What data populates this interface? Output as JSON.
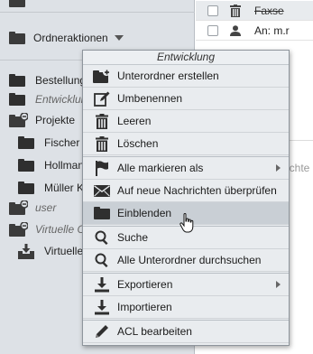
{
  "sidebar": {
    "folder_actions_label": "Ordneraktionen",
    "items": [
      {
        "label": "Bestellung",
        "indent": 0,
        "style": "normal",
        "icon": "folder-icon"
      },
      {
        "label": "Entwicklun",
        "indent": 0,
        "style": "italic",
        "icon": "folder-icon"
      },
      {
        "label": "Projekte",
        "indent": 0,
        "style": "normal",
        "icon": "folder-collapse-icon"
      },
      {
        "label": "Fischer",
        "indent": 1,
        "style": "normal",
        "icon": "folder-icon"
      },
      {
        "label": "Hollman",
        "indent": 1,
        "style": "normal",
        "icon": "folder-icon"
      },
      {
        "label": "Müller K",
        "indent": 1,
        "style": "normal",
        "icon": "folder-icon"
      },
      {
        "label": "user",
        "indent": 0,
        "style": "italic",
        "icon": "folder-collapse-icon"
      },
      {
        "label": "Virtuelle O",
        "indent": 0,
        "style": "italic",
        "icon": "folder-collapse-icon"
      },
      {
        "label": "Virtuelle",
        "indent": 1,
        "style": "normal",
        "icon": "inbox-download-icon"
      }
    ]
  },
  "messages": [
    {
      "text": "Faxse",
      "strike": true,
      "icon": "trash-icon"
    },
    {
      "text": "An: m.r",
      "strike": false,
      "icon": "user-icon"
    }
  ],
  "background_text": "ichte",
  "context_menu": {
    "title": "Entwicklung",
    "groups": [
      [
        {
          "label": "Unterordner erstellen",
          "icon": "folder-add-icon"
        },
        {
          "label": "Umbenennen",
          "icon": "edit-icon"
        },
        {
          "label": "Leeren",
          "icon": "trash-icon"
        },
        {
          "label": "Löschen",
          "icon": "trash-icon"
        }
      ],
      [
        {
          "label": "Alle markieren als",
          "icon": "flag-icon",
          "submenu": true
        },
        {
          "label": "Auf neue Nachrichten überprüfen",
          "icon": "envelope-icon"
        },
        {
          "label": "Einblenden",
          "icon": "folder-icon",
          "hover": true
        }
      ],
      [
        {
          "label": "Suche",
          "icon": "search-icon"
        },
        {
          "label": "Alle Unterordner durchsuchen",
          "icon": "search-icon"
        }
      ],
      [
        {
          "label": "Exportieren",
          "icon": "export-icon",
          "submenu": true
        },
        {
          "label": "Importieren",
          "icon": "import-icon"
        }
      ],
      [
        {
          "label": "ACL bearbeiten",
          "icon": "pencil-icon"
        }
      ]
    ]
  },
  "colors": {
    "sidebar_bg": "#dde1e6",
    "menu_bg": "#e9ecef",
    "menu_hover": "#c9cfd5",
    "icon": "#3b3b3b"
  }
}
